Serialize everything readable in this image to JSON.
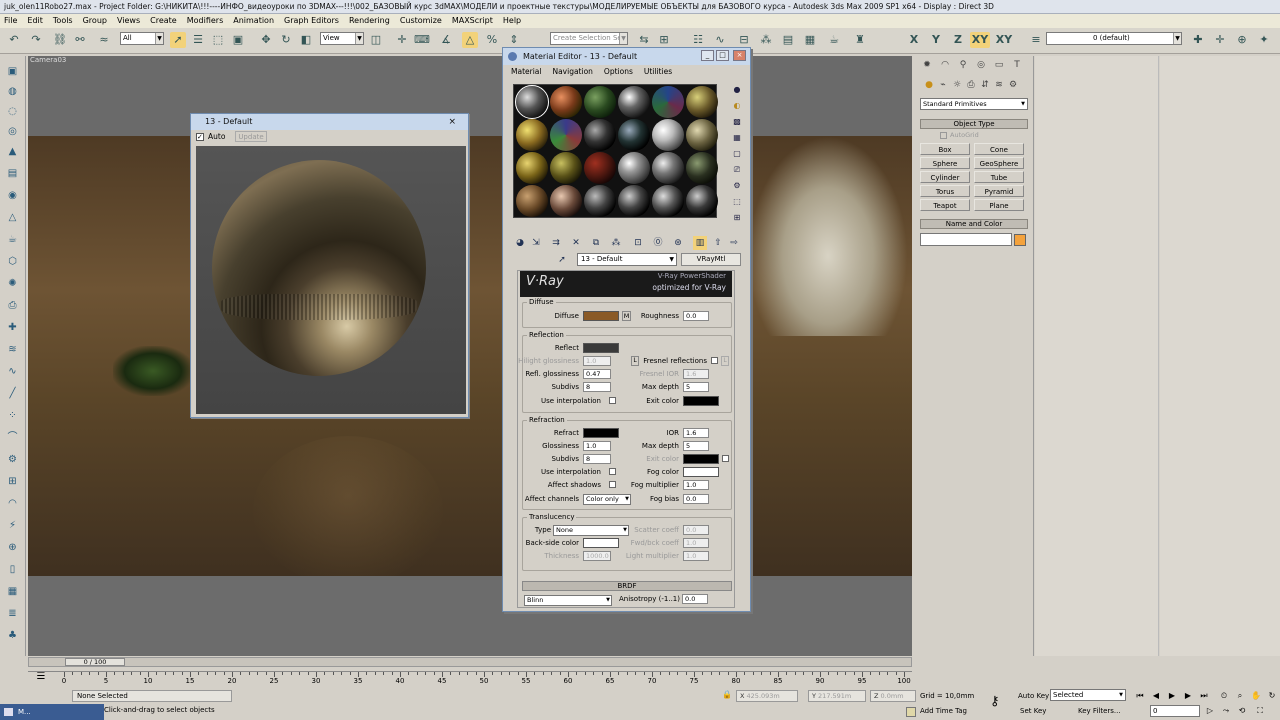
{
  "title": "juk_olen11Robo27.max   - Project Folder: G:\\НИКИТА\\!!!----ИНФО_видеоуроки по 3DMAX---!!!\\002_БАЗОВЫЙ курс 3dMAX\\МОДЕЛИ и проектные текстуры\\МОДЕЛИРУЕМЫЕ ОБЪЕКТЫ для БАЗОВОГО курса    - Autodesk 3ds Max  2009 SP1  x64       - Display : Direct 3D",
  "menu": [
    "File",
    "Edit",
    "Tools",
    "Group",
    "Views",
    "Create",
    "Modifiers",
    "Animation",
    "Graph Editors",
    "Rendering",
    "Customize",
    "MAXScript",
    "Help"
  ],
  "toolbar": {
    "filter": "All",
    "refcoord": "View",
    "selection_set": "Create Selection Se",
    "axes": [
      "X",
      "Y",
      "Z",
      "XY",
      "XY"
    ],
    "layer": "0 (default)"
  },
  "viewport": {
    "label": "Camera03"
  },
  "preview": {
    "title": "13 - Default",
    "auto_label": "Auto",
    "update_label": "Update",
    "close": "×"
  },
  "material_editor": {
    "title": "Material Editor - 13 - Default",
    "menu": [
      "Material",
      "Navigation",
      "Options",
      "Utilities"
    ],
    "material_name": "13 - Default",
    "material_type": "VRayMtl",
    "banner_logo": "V·Ray",
    "banner_line1": "V-Ray PowerShader",
    "banner_line2": "optimized for V-Ray",
    "diffuse": {
      "group": "Diffuse",
      "label": "Diffuse",
      "map_btn": "M",
      "roughness_label": "Roughness",
      "roughness": "0.0",
      "color": "#8a5a26"
    },
    "reflection": {
      "group": "Reflection",
      "reflect_label": "Reflect",
      "reflect_color": "#3a3a3a",
      "hilight_label": "Hilight glossiness",
      "hilight": "1.0",
      "lock": "L",
      "fresnel_label": "Fresnel reflections",
      "fresnel_lock": "L",
      "refl_gloss_label": "Refl. glossiness",
      "refl_gloss": "0.47",
      "fresnel_ior_label": "Fresnel IOR",
      "fresnel_ior": "1.6",
      "subdivs_label": "Subdivs",
      "subdivs": "8",
      "max_depth_label": "Max depth",
      "max_depth": "5",
      "use_interp_label": "Use interpolation",
      "exit_color_label": "Exit color",
      "exit_color": "#000000"
    },
    "refraction": {
      "group": "Refraction",
      "refract_label": "Refract",
      "refract_color": "#000000",
      "ior_label": "IOR",
      "ior": "1.6",
      "gloss_label": "Glossiness",
      "gloss": "1.0",
      "max_depth_label": "Max depth",
      "max_depth": "5",
      "subdivs_label": "Subdivs",
      "subdivs": "8",
      "exit_color_label": "Exit color",
      "use_interp_label": "Use interpolation",
      "fog_color_label": "Fog color",
      "fog_color": "#ffffff",
      "affect_shadows_label": "Affect shadows",
      "fog_mult_label": "Fog multiplier",
      "fog_mult": "1.0",
      "affect_channels_label": "Affect channels",
      "affect_channels": "Color only",
      "fog_bias_label": "Fog bias",
      "fog_bias": "0.0"
    },
    "translucency": {
      "group": "Translucency",
      "type_label": "Type",
      "type": "None",
      "scatter_label": "Scatter coeff",
      "scatter": "0.0",
      "backside_label": "Back-side color",
      "backside_color": "#ffffff",
      "fwdbck_label": "Fwd/bck coeff",
      "fwdbck": "1.0",
      "thickness_label": "Thickness",
      "thickness": "1000.0",
      "light_mult_label": "Light multiplier",
      "light_mult": "1.0"
    },
    "brdf": {
      "head": "BRDF",
      "type": "Blinn",
      "aniso_label": "Anisotropy (-1..1)",
      "aniso": "0.0"
    }
  },
  "command_panel": {
    "category": "Standard Primitives",
    "object_type_head": "Object Type",
    "autogrid": "AutoGrid",
    "buttons": [
      "Box",
      "Cone",
      "Sphere",
      "GeoSphere",
      "Cylinder",
      "Tube",
      "Torus",
      "Pyramid",
      "Teapot",
      "Plane"
    ],
    "name_color_head": "Name and Color",
    "object_color": "#f4a23c"
  },
  "timeline": {
    "frame_range": "0 / 100",
    "ticks": [
      "0",
      "5",
      "10",
      "15",
      "20",
      "25",
      "30",
      "35",
      "40",
      "45",
      "50",
      "55",
      "60",
      "65",
      "70",
      "75",
      "80",
      "85",
      "90",
      "95",
      "100"
    ]
  },
  "status": {
    "selection": "None Selected",
    "prompt": "Click-and-drag to select objects",
    "x": "425.093m",
    "y": "217.591m",
    "z": "0.0mm",
    "grid": "Grid = 10,0mm",
    "add_time_tag": "Add Time Tag",
    "auto_key": "Auto Key",
    "set_key": "Set Key",
    "selected": "Selected",
    "key_filters": "Key Filters...",
    "frame": "0",
    "taskbar": "M..."
  }
}
